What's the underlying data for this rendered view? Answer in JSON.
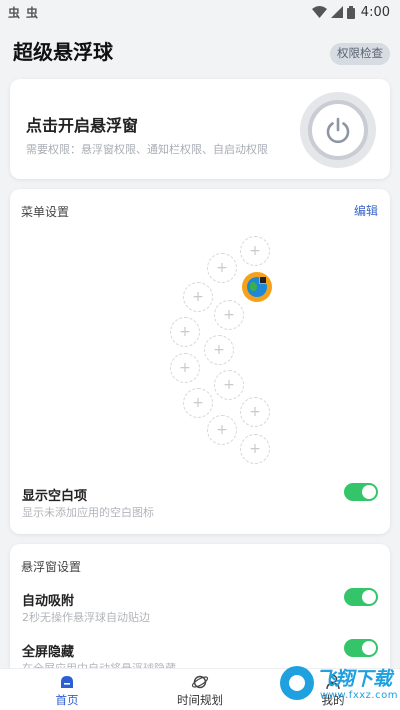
{
  "status_bar": {
    "time": "4:00",
    "left_glyphs": [
      "虫",
      "虫"
    ]
  },
  "header": {
    "title": "超级悬浮球",
    "permission_button": "权限检查"
  },
  "open_card": {
    "title": "点击开启悬浮窗",
    "description": "需要权限：悬浮窗权限、通知栏权限、自启动权限"
  },
  "menu_card": {
    "section_title": "菜单设置",
    "edit_label": "编辑",
    "slot_symbol": "+",
    "show_blank": {
      "title": "显示空白项",
      "subtitle": "显示未添加应用的空白图标",
      "enabled": true
    }
  },
  "float_card": {
    "section_title": "悬浮窗设置",
    "auto_attach": {
      "title": "自动吸附",
      "subtitle": "2秒无操作悬浮球自动贴边",
      "enabled": true
    },
    "fullscreen_hide": {
      "title": "全屏隐藏",
      "subtitle": "在全屏应用中自动将悬浮球隐藏",
      "enabled": true
    }
  },
  "bottom_nav": {
    "items": [
      {
        "label": "首页",
        "icon": "home-icon",
        "active": true
      },
      {
        "label": "时间规划",
        "icon": "planet-icon",
        "active": false
      },
      {
        "label": "我的",
        "icon": "profile-icon",
        "active": false
      }
    ]
  },
  "watermark": {
    "text": "飞翔下载",
    "url": "www.fxxz.com"
  },
  "colors": {
    "accent": "#2d5fd3",
    "toggle_on": "#34c46a",
    "link": "#3a66c8",
    "app_bubble": "#f4a21b"
  }
}
